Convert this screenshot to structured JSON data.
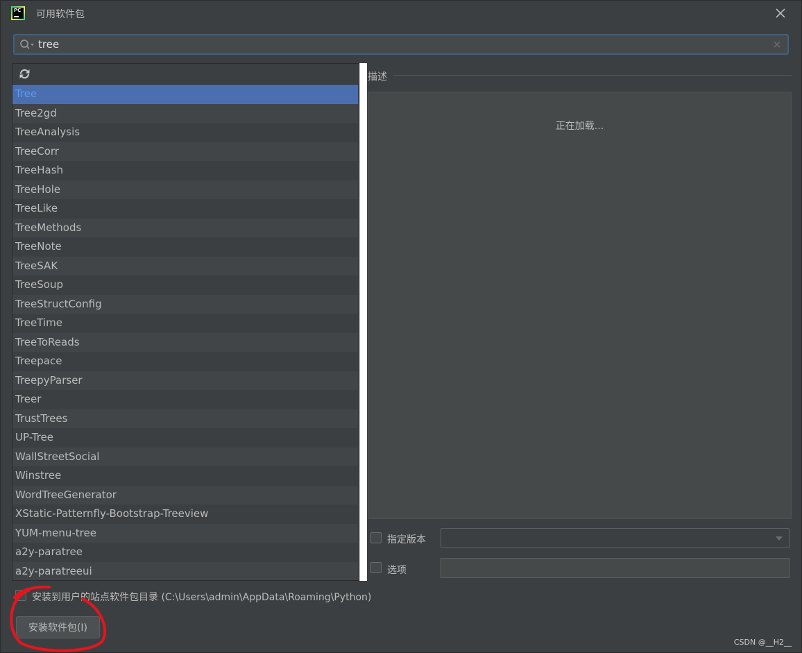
{
  "window": {
    "title": "可用软件包",
    "app_icon_text": "PC"
  },
  "search": {
    "value": "tree"
  },
  "packages": [
    "Tree",
    "Tree2gd",
    "TreeAnalysis",
    "TreeCorr",
    "TreeHash",
    "TreeHole",
    "TreeLike",
    "TreeMethods",
    "TreeNote",
    "TreeSAK",
    "TreeSoup",
    "TreeStructConfig",
    "TreeTime",
    "TreeToReads",
    "Treepace",
    "TreepyParser",
    "Treer",
    "TrustTrees",
    "UP-Tree",
    "WallStreetSocial",
    "Winstree",
    "WordTreeGenerator",
    "XStatic-Patternfly-Bootstrap-Treeview",
    "YUM-menu-tree",
    "a2y-paratree",
    "a2y-paratreeui"
  ],
  "selected_package": "Tree",
  "description": {
    "label": "描述",
    "loading_text": "正在加载..."
  },
  "options": {
    "specify_version_label": "指定版本",
    "specify_version_checked": false,
    "version_value": "",
    "options_label": "选项",
    "options_checked": false,
    "options_value": ""
  },
  "install_to_user": {
    "label": "安装到用户的站点软件包目录 (C:\\Users\\admin\\AppData\\Roaming\\Python)",
    "checked": false
  },
  "install_button": {
    "label": "安装软件包(I)"
  },
  "watermark": "CSDN @__H2__",
  "colors": {
    "window_bg": "#3c3f41",
    "selection_bg": "#4b6eaf",
    "selection_text": "#589df6",
    "focus_border": "#3d6185",
    "annotation_red": "#e8141d"
  }
}
